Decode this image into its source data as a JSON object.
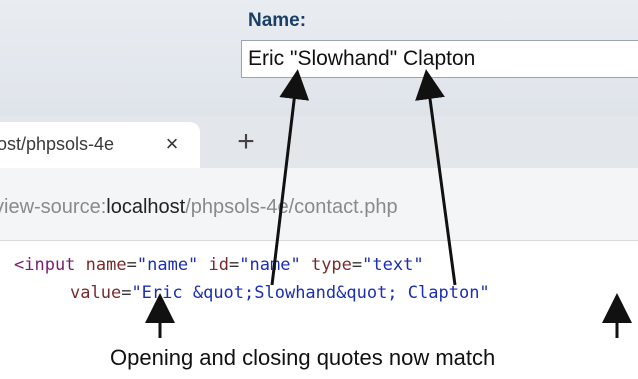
{
  "form": {
    "label": "Name:",
    "value": "Eric \"Slowhand\" Clapton"
  },
  "tab": {
    "title": "ost/phpsols-4e",
    "close_glyph": "×",
    "new_tab_glyph": "+"
  },
  "address": {
    "prefix": "view-source:",
    "host": "localhost",
    "path": "/phpsols-4e/contact.php"
  },
  "source": {
    "line1": {
      "tag_open": "<input",
      "attr1": "name",
      "val1": "\"name\"",
      "attr2": "id",
      "val2": "\"name\"",
      "attr3": "type",
      "val3": "\"text\""
    },
    "line2": {
      "attr": "value",
      "val": "\"Eric &quot;Slowhand&quot; Clapton\""
    },
    "equals": "="
  },
  "caption": "Opening and closing quotes now match"
}
